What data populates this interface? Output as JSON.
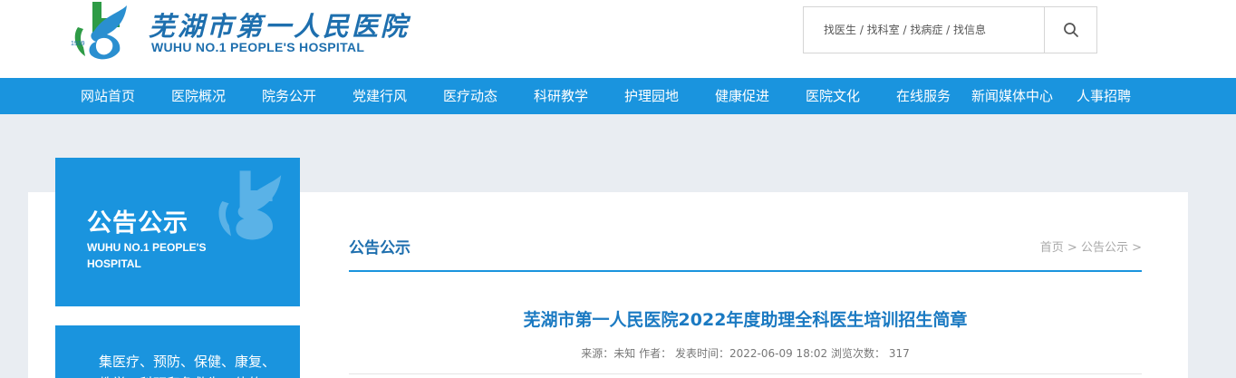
{
  "header": {
    "logo_cn": "芜湖市第一人民医院",
    "logo_en": "WUHU NO.1 PEOPLE'S HOSPITAL",
    "logo_year": "1939"
  },
  "search": {
    "placeholder": "找医生 / 找科室 / 找病症 / 找信息",
    "icon": "search-icon"
  },
  "nav": {
    "items": [
      "网站首页",
      "医院概况",
      "院务公开",
      "党建行风",
      "医疗动态",
      "科研教学",
      "护理园地",
      "健康促进",
      "医院文化",
      "在线服务",
      "新闻媒体中心",
      "人事招聘"
    ]
  },
  "sidebar": {
    "title_cn": "公告公示",
    "title_en": "WUHU NO.1 PEOPLE'S HOSPITAL",
    "intro": "集医疗、预防、保健、康复、教学、科研和急救为一体的"
  },
  "section": {
    "title": "公告公示",
    "breadcrumb": [
      "首页",
      ">",
      "公告公示",
      ">"
    ]
  },
  "article": {
    "title": "芜湖市第一人民医院2022年度助理全科医生培训招生简章",
    "source_label": "来源：",
    "source": "未知",
    "author_label": "作者：",
    "author": "",
    "date_label": "发表时间：",
    "date": "2022-06-09 18:02",
    "views_label": "浏览次数：",
    "views": "317"
  },
  "colors": {
    "primary": "#1a94de",
    "brand_text": "#1e6fae",
    "title_blue": "#1b7ac2",
    "page_bg": "#e9edf2"
  }
}
